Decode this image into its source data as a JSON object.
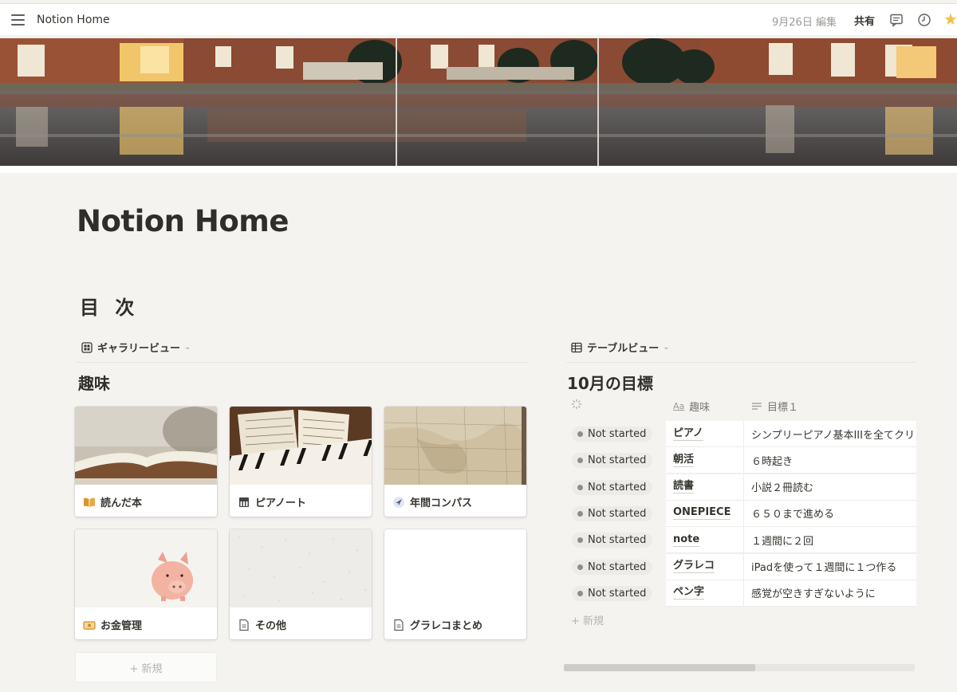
{
  "topbar": {
    "page_name": "Notion Home",
    "edited": "9月26日 編集",
    "share_label": "共有",
    "icons": [
      "menu-icon",
      "comment-icon",
      "history-icon",
      "favorite-star-icon"
    ]
  },
  "page": {
    "title": "Notion Home",
    "toc_heading": "目 次"
  },
  "gallery": {
    "view_label": "ギャラリービュー",
    "db_title": "趣味",
    "new_label": "+ 新規",
    "cards": [
      {
        "label": "読んだ本",
        "icon": "book-icon"
      },
      {
        "label": "ピアノート",
        "icon": "piano-icon"
      },
      {
        "label": "年間コンパス",
        "icon": "compass-icon"
      },
      {
        "label": "お金管理",
        "icon": "money-icon"
      },
      {
        "label": "その他",
        "icon": "page-icon"
      },
      {
        "label": "グラレコまとめ",
        "icon": "page-icon"
      }
    ]
  },
  "table": {
    "view_label": "テーブルビュー",
    "db_title": "10月の目標",
    "columns": [
      "趣味",
      "目標１"
    ],
    "new_label": "+ 新規",
    "rows": [
      {
        "status": "Not started",
        "name": "ピアノ",
        "goal": "シンプリーピアノ基本IIIを全てクリ"
      },
      {
        "status": "Not started",
        "name": "朝活",
        "goal": "６時起き"
      },
      {
        "status": "Not started",
        "name": "読書",
        "goal": "小説２冊読む"
      },
      {
        "status": "Not started",
        "name": "ONEPIECE",
        "goal": "６５０まで進める"
      },
      {
        "status": "Not started",
        "name": "note",
        "goal": "１週間に２回"
      },
      {
        "status": "Not started",
        "name": "グラレコ",
        "goal": "iPadを使って１週間に１つ作る"
      },
      {
        "status": "Not started",
        "name": "ペン字",
        "goal": "感覚が空きすぎないように"
      }
    ]
  },
  "colors": {
    "page_bg": "#f4f3f0",
    "text": "#37352f",
    "muted": "#9b9a97",
    "star": "#f2c04a",
    "status_dot": "#8e8d89"
  }
}
